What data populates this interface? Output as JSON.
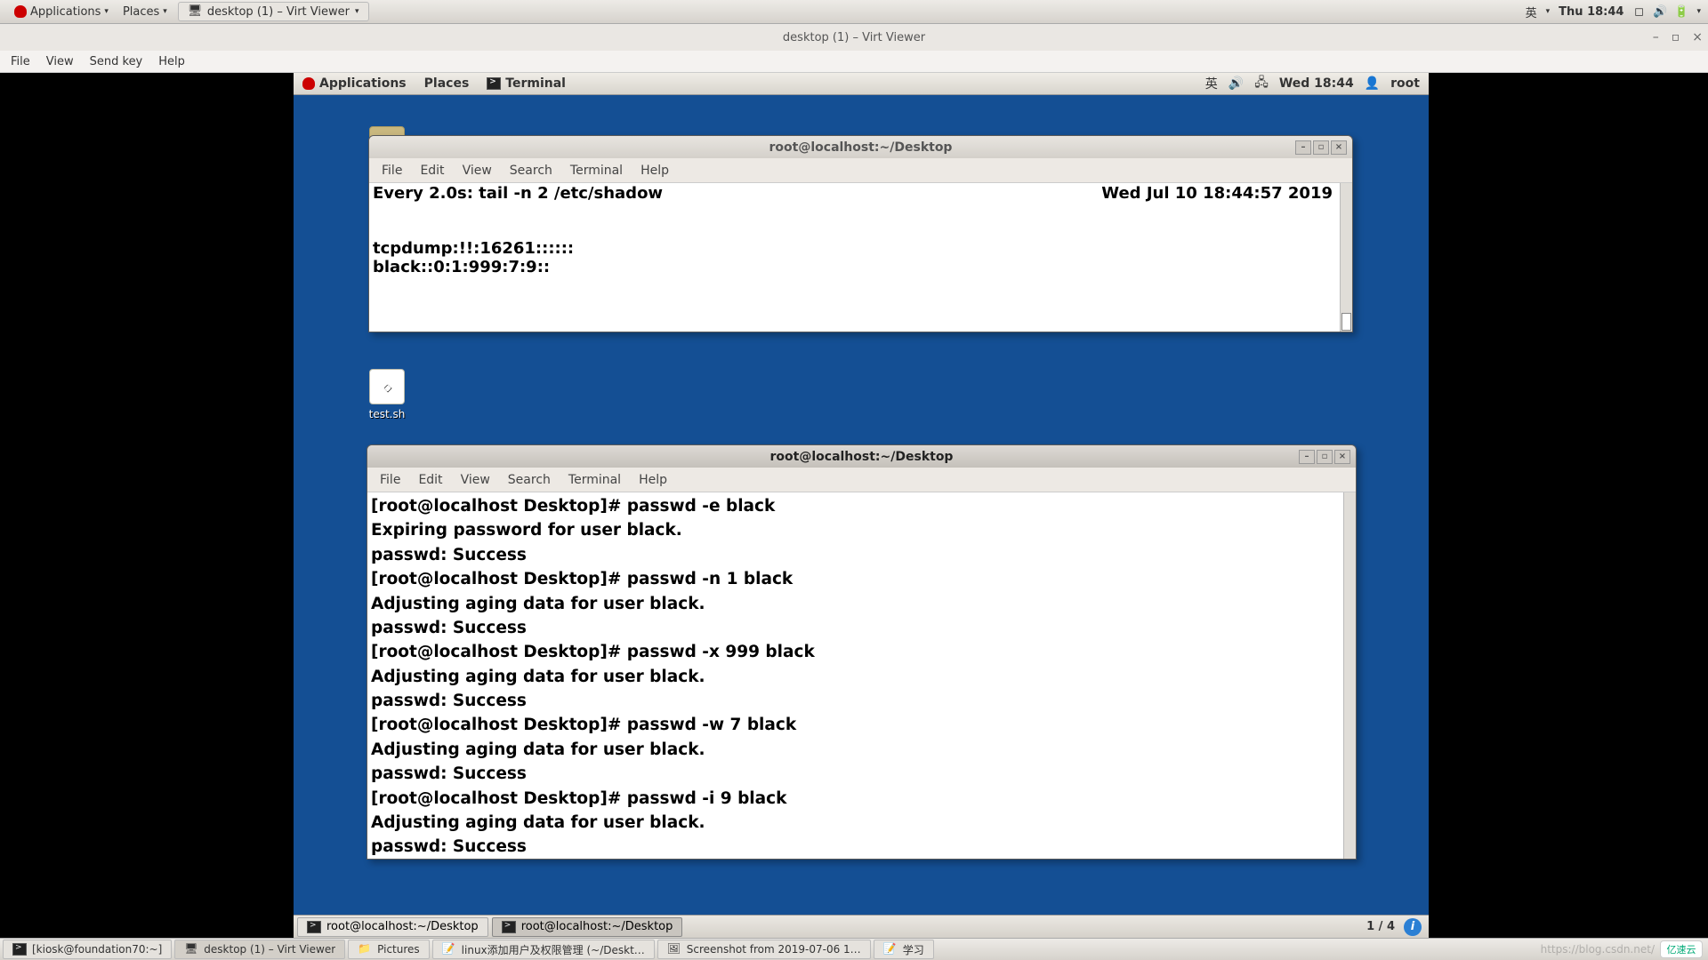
{
  "host": {
    "topbar": {
      "applications": "Applications",
      "places": "Places",
      "running_app": "desktop (1) – Virt Viewer",
      "ime": "英",
      "clock": "Thu 18:44"
    },
    "bottombar": {
      "items": [
        "[kiosk@foundation70:~]",
        "desktop (1) – Virt Viewer",
        "Pictures",
        "linux添加用户及权限管理 (~/Deskt…",
        "Screenshot from 2019-07-06 1…",
        "学习"
      ],
      "watermark_url": "https://blog.csdn.net/",
      "logo_text": "亿速云"
    }
  },
  "virt": {
    "title": "desktop (1) – Virt Viewer",
    "menu": {
      "file": "File",
      "view": "View",
      "sendkey": "Send key",
      "help": "Help"
    }
  },
  "guest": {
    "panel": {
      "applications": "Applications",
      "places": "Places",
      "terminal": "Terminal",
      "ime": "英",
      "clock": "Wed 18:44",
      "user": "root"
    },
    "taskbar": {
      "btn1": "root@localhost:~/Desktop",
      "btn2": "root@localhost:~/Desktop",
      "pager": "1 / 4"
    },
    "desktop_icons": {
      "folder_visible_fragment": "",
      "script": "test.sh"
    }
  },
  "term1": {
    "title": "root@localhost:~/Desktop",
    "menu": {
      "file": "File",
      "edit": "Edit",
      "view": "View",
      "search": "Search",
      "terminal": "Terminal",
      "help": "Help"
    },
    "watch_header_left": "Every 2.0s: tail -n 2 /etc/shadow",
    "watch_header_right": "Wed Jul 10 18:44:57 2019",
    "line1": "tcpdump:!!:16261::::::",
    "line2": "black::0:1:999:7:9::"
  },
  "term2": {
    "title": "root@localhost:~/Desktop",
    "menu": {
      "file": "File",
      "edit": "Edit",
      "view": "View",
      "search": "Search",
      "terminal": "Terminal",
      "help": "Help"
    },
    "lines": [
      "[root@localhost Desktop]# passwd -e black",
      "Expiring password for user black.",
      "passwd: Success",
      "[root@localhost Desktop]# passwd -n 1 black",
      "Adjusting aging data for user black.",
      "passwd: Success",
      "[root@localhost Desktop]# passwd -x 999 black",
      "Adjusting aging data for user black.",
      "passwd: Success",
      "[root@localhost Desktop]# passwd -w 7 black",
      "Adjusting aging data for user black.",
      "passwd: Success",
      "[root@localhost Desktop]# passwd -i 9 black",
      "Adjusting aging data for user black.",
      "passwd: Success"
    ]
  }
}
